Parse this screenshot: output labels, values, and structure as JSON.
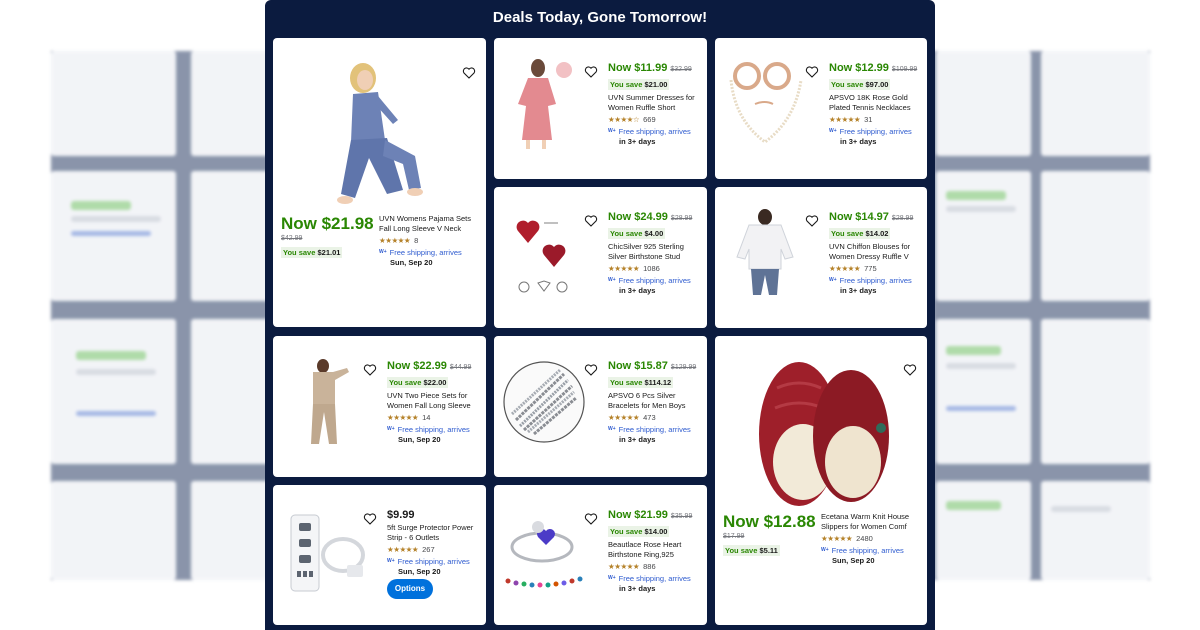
{
  "modal": {
    "title": "Deals Today, Gone Tomorrow!"
  },
  "colors": {
    "modal_bg": "#0b1b3f",
    "price_green": "#2a8703",
    "link_blue": "#2e5bcf",
    "button_blue": "#0071dc"
  },
  "products": [
    {
      "now": "Now $21.98",
      "was": "$42.99",
      "save_label": "You save",
      "save_amount": "$21.01",
      "title": "UVN Womens Pajama Sets Fall Long Sleeve V Neck",
      "stars": "★★★★★",
      "reviews": "8",
      "ship_prefix": "W+",
      "ship_text": "Free shipping, arrives",
      "ship_when": "Sun, Sep 20",
      "image": "woman-pajama-set"
    },
    {
      "now": "Now $11.99",
      "was": "$32.99",
      "save_label": "You save",
      "save_amount": "$21.00",
      "title": "UVN Summer Dresses for Women Ruffle Short",
      "stars": "★★★★☆",
      "reviews": "669",
      "ship_prefix": "W+",
      "ship_text": "Free shipping, arrives",
      "ship_when": "in 3+ days",
      "image": "pink-dress"
    },
    {
      "now": "Now $12.99",
      "was": "$109.99",
      "save_label": "You save",
      "save_amount": "$97.00",
      "title": "APSVO 18K Rose Gold Plated Tennis Necklaces",
      "stars": "★★★★★",
      "reviews": "31",
      "ship_prefix": "W+",
      "ship_text": "Free shipping, arrives",
      "ship_when": "in 3+ days",
      "image": "pearl-necklace"
    },
    {
      "now": "Now $24.99",
      "was": "$28.99",
      "save_label": "You save",
      "save_amount": "$4.00",
      "title": "ChicSilver 925 Sterling Silver Birthstone Stud",
      "stars": "★★★★★",
      "reviews": "1086",
      "ship_prefix": "W+",
      "ship_text": "Free shipping, arrives",
      "ship_when": "in 3+ days",
      "image": "heart-stud-earrings"
    },
    {
      "now": "Now $14.97",
      "was": "$28.99",
      "save_label": "You save",
      "save_amount": "$14.02",
      "title": "UVN Chiffon Blouses for Women Dressy Ruffle V",
      "stars": "★★★★★",
      "reviews": "775",
      "ship_prefix": "W+",
      "ship_text": "Free shipping, arrives",
      "ship_when": "in 3+ days",
      "image": "white-blouse"
    },
    {
      "now": "Now $22.99",
      "was": "$44.99",
      "save_label": "You save",
      "save_amount": "$22.00",
      "title": "UVN Two Piece Sets for Women Fall Long Sleeve",
      "stars": "★★★★★",
      "reviews": "14",
      "ship_prefix": "W+",
      "ship_text": "Free shipping, arrives",
      "ship_when": "Sun, Sep 20",
      "image": "beige-jumpsuit"
    },
    {
      "now": "Now $15.87",
      "was": "$129.99",
      "save_label": "You save",
      "save_amount": "$114.12",
      "title": "APSVO 6 Pcs Silver Bracelets for Men Boys",
      "stars": "★★★★★",
      "reviews": "473",
      "ship_prefix": "W+",
      "ship_text": "Free shipping, arrives",
      "ship_when": "in 3+ days",
      "image": "silver-bracelets"
    },
    {
      "now": "Now $12.88",
      "was": "$17.99",
      "save_label": "You save",
      "save_amount": "$5.11",
      "title": "Ecetana Warm Knit House Slippers for Women Comf",
      "stars": "★★★★★",
      "reviews": "2480",
      "ship_prefix": "W+",
      "ship_text": "Free shipping, arrives",
      "ship_when": "Sun, Sep 20",
      "image": "red-knit-slippers"
    },
    {
      "now": "$9.99",
      "was": "",
      "save_label": "",
      "save_amount": "",
      "title": "5ft Surge Protector Power Strip - 6 Outlets",
      "stars": "★★★★★",
      "reviews": "267",
      "ship_prefix": "W+",
      "ship_text": "Free shipping, arrives",
      "ship_when": "Sun, Sep 20",
      "image": "power-strip",
      "button": "Options"
    },
    {
      "now": "Now $21.99",
      "was": "$35.99",
      "save_label": "You save",
      "save_amount": "$14.00",
      "title": "Beautlace Rose Heart Birthstone Ring,925",
      "stars": "★★★★★",
      "reviews": "886",
      "ship_prefix": "W+",
      "ship_text": "Free shipping, arrives",
      "ship_when": "in 3+ days",
      "image": "rose-heart-ring"
    }
  ]
}
